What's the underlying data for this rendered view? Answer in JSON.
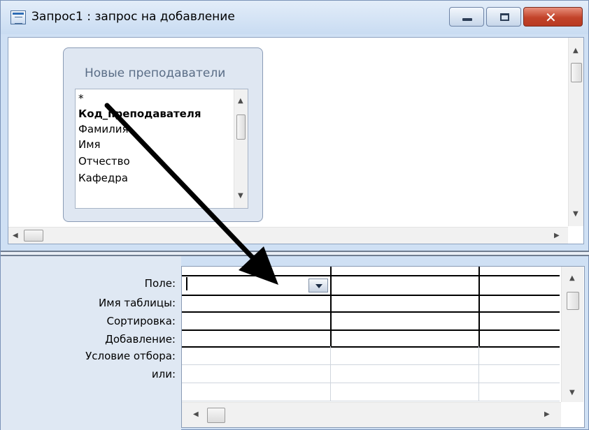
{
  "window": {
    "title": "Запрос1 : запрос на добавление",
    "controls": [
      "minimize",
      "maximize",
      "close"
    ],
    "close_glyph": "✕"
  },
  "field_list": {
    "table_name": "Новые преподаватели",
    "fields": [
      {
        "label": "*",
        "bold": false
      },
      {
        "label": "Код_преподавателя",
        "bold": true
      },
      {
        "label": "Фамилия",
        "bold": false
      },
      {
        "label": "Имя",
        "bold": false
      },
      {
        "label": "Отчество",
        "bold": false
      },
      {
        "label": "Кафедра",
        "bold": false
      }
    ]
  },
  "design_grid": {
    "row_labels": [
      "Поле:",
      "Имя таблицы:",
      "Сортировка:",
      "Добавление:",
      "Условие отбора:",
      "или:"
    ],
    "field_value": ""
  },
  "icons": {
    "app": "query-icon",
    "scroll_up": "▲",
    "scroll_down": "▼",
    "scroll_left": "◀",
    "scroll_right": "▶"
  },
  "colors": {
    "frame": "#cfe0f4",
    "close_button": "#c2432a",
    "annotation_arrow": "#000000"
  }
}
